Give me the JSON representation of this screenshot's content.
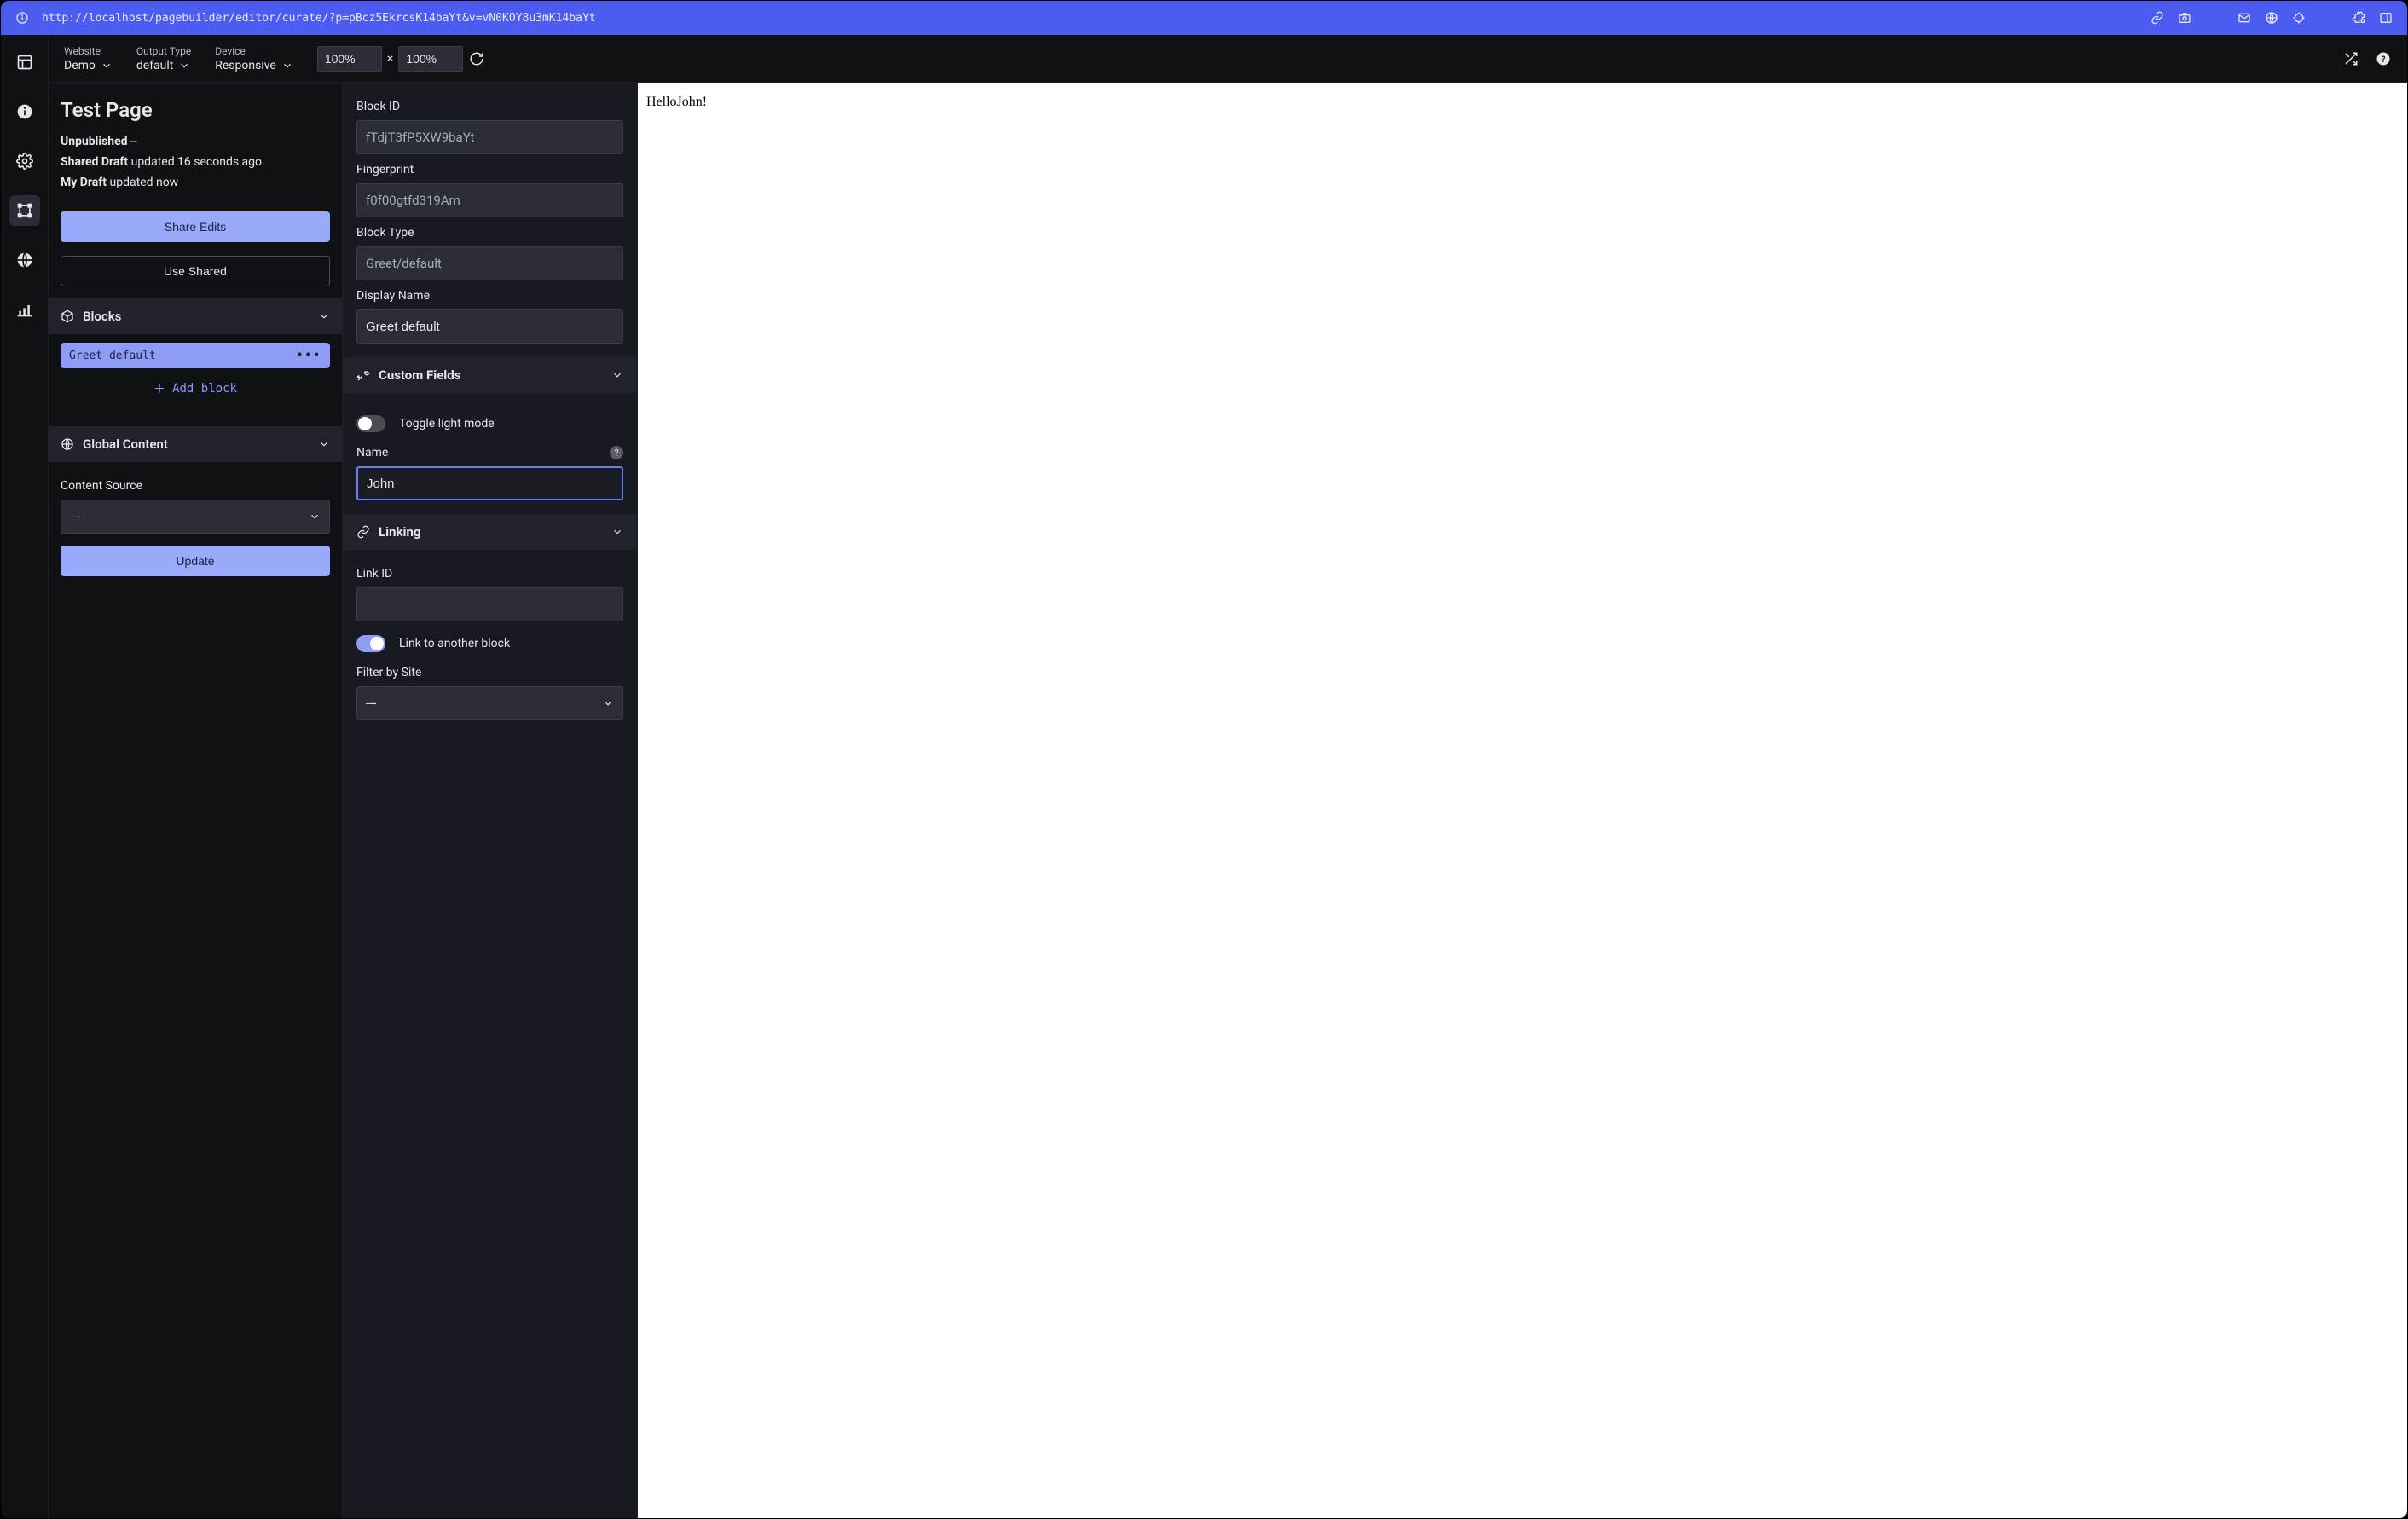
{
  "browser": {
    "url": "http://localhost/pagebuilder/editor/curate/?p=pBcz5EkrcsK14baYt&v=vN0KOY8u3mK14baYt"
  },
  "topbar": {
    "website_label": "Website",
    "website_value": "Demo",
    "output_label": "Output Type",
    "output_value": "default",
    "device_label": "Device",
    "device_value": "Responsive",
    "zoom_w": "100%",
    "zoom_h": "100%"
  },
  "page": {
    "title": "Test Page",
    "unpublished": "Unpublished",
    "unpublished_suffix": " --",
    "shared_label": "Shared Draft",
    "shared_suffix": " updated 16 seconds ago",
    "my_label": "My Draft",
    "my_suffix": " updated now",
    "share_btn": "Share Edits",
    "use_btn": "Use Shared"
  },
  "blocks": {
    "header": "Blocks",
    "items": [
      "Greet default"
    ],
    "add": "Add block"
  },
  "global": {
    "header": "Global Content",
    "content_source_label": "Content Source",
    "content_source_value": "---",
    "update_btn": "Update"
  },
  "mid": {
    "block_id_label": "Block ID",
    "block_id_value": "fTdjT3fP5XW9baYt",
    "fingerprint_label": "Fingerprint",
    "fingerprint_value": "f0f00gtfd319Am",
    "block_type_label": "Block Type",
    "block_type_value": "Greet/default",
    "display_name_label": "Display Name",
    "display_name_value": "Greet default",
    "custom_fields_header": "Custom Fields",
    "toggle_light": "Toggle light mode",
    "name_label": "Name",
    "name_value": "John",
    "linking_header": "Linking",
    "link_id_label": "Link ID",
    "link_id_value": "",
    "link_other_label": "Link to another block",
    "filter_site_label": "Filter by Site",
    "filter_site_value": "---"
  },
  "preview": {
    "text": "HelloJohn!"
  }
}
